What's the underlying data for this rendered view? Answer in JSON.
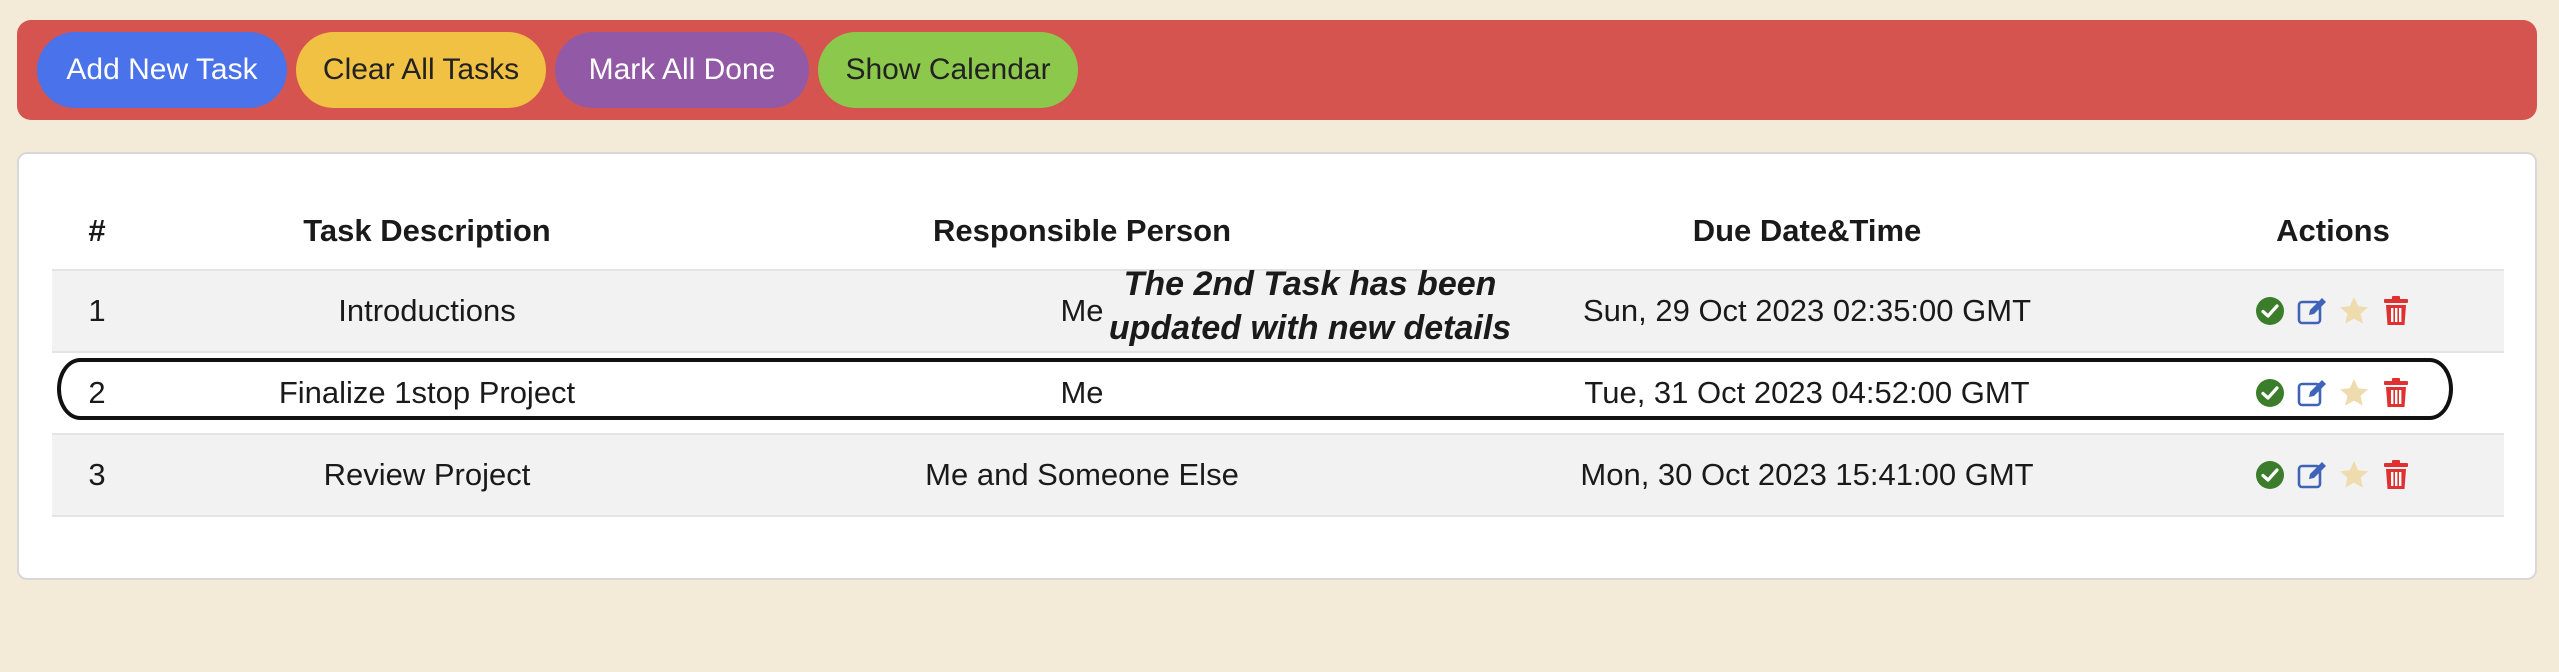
{
  "toolbar": {
    "add_label": "Add New Task",
    "clear_label": "Clear All Tasks",
    "done_label": "Mark All Done",
    "calendar_label": "Show Calendar"
  },
  "table": {
    "headers": [
      "#",
      "Task Description",
      "Responsible Person",
      "Due Date&Time",
      "Actions"
    ],
    "rows": [
      {
        "num": "1",
        "description": "Introductions",
        "person": "Me",
        "due": "Sun, 29 Oct 2023 02:35:00 GMT"
      },
      {
        "num": "2",
        "description": "Finalize 1stop Project",
        "person": "Me",
        "due": "Tue, 31 Oct 2023 04:52:00 GMT"
      },
      {
        "num": "3",
        "description": "Review Project",
        "person": "Me and Someone Else",
        "due": "Mon, 30 Oct 2023 15:41:00 GMT"
      }
    ]
  },
  "annotation": {
    "line1": "The 2nd Task has been",
    "line2": "updated with new details"
  },
  "icons": {
    "complete": "check-circle-icon",
    "edit": "edit-icon",
    "favorite": "star-icon",
    "delete": "trash-icon"
  },
  "colors": {
    "toolbar_bg": "#d6544f",
    "add": "#4a72ea",
    "clear": "#f0c142",
    "done": "#9159a6",
    "calendar": "#8cc84b",
    "check": "#3b7d2b",
    "edit": "#3e63b8",
    "star": "#efdcae",
    "trash": "#e03030"
  }
}
